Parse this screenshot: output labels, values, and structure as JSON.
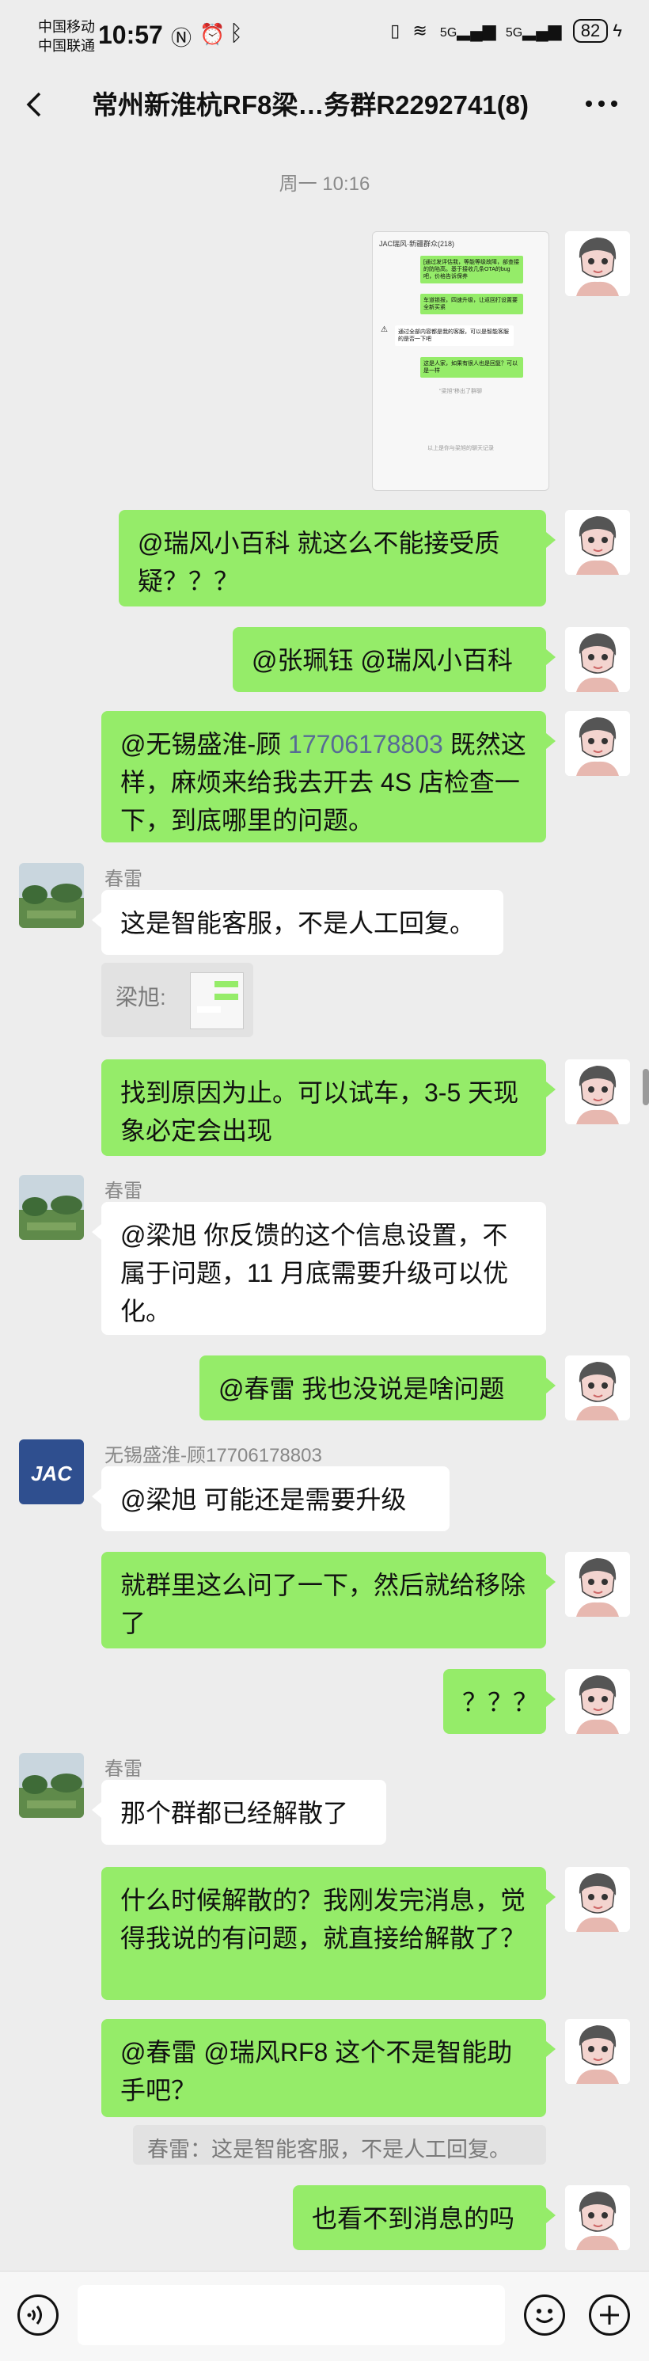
{
  "status_bar": {
    "carrier_1": "中国移动",
    "carrier_2": "中国联通",
    "time": "10:57",
    "battery": "82",
    "net_1": "5G",
    "net_2": "5G"
  },
  "header": {
    "title": "常州新淮杭RF8梁…务群R2292741(8)"
  },
  "timestamp": "周一 10:16",
  "screenshot_card": {
    "title": "JAC瑞风·新疆群众(218)",
    "reply_1": "[通过发评估我，等能等级故障，部查接的防陷高。基于接收几条OTA的bug吧，价格告诉保养",
    "reply_2": "车道锁报，四速升级，让返回打设置要全新买紧",
    "notice": "通过全部内容都是我的客服，可以是智能客服的是否一下吧",
    "reply_3": "这是人家，如果有很人也是回复？可以是一样",
    "footer_1": "\"梁旭\"移出了群聊",
    "footer_2": "以上是你与梁旭的聊天记录"
  },
  "messages": [
    {
      "id": "m1",
      "text": "@瑞风小百科  就这么不能接受质疑？？？"
    },
    {
      "id": "m2",
      "text": "@张珮钰  @瑞风小百科"
    },
    {
      "id": "m3a",
      "text": "@无锡盛淮-顾"
    },
    {
      "id": "m3b",
      "text": "17706178803"
    },
    {
      "id": "m3c",
      "text": " 既然这样，麻烦来给我去开去 4S 店检查一下，到底哪里的问题。"
    },
    {
      "id": "m4_sender",
      "text": "春雷"
    },
    {
      "id": "m4",
      "text": "这是智能客服，不是人工回复。"
    },
    {
      "id": "m4_quote",
      "text": "梁旭:"
    },
    {
      "id": "m5",
      "text": "找到原因为止。可以试车，3-5 天现象必定会出现"
    },
    {
      "id": "m6_sender",
      "text": "春雷"
    },
    {
      "id": "m6",
      "text": "@梁旭  你反馈的这个信息设置，不属于问题，11 月底需要升级可以优化。"
    },
    {
      "id": "m7",
      "text": "@春雷  我也没说是啥问题"
    },
    {
      "id": "m8_sender",
      "text": "无锡盛淮-顾17706178803"
    },
    {
      "id": "m8",
      "text": "@梁旭  可能还是需要升级"
    },
    {
      "id": "m9",
      "text": "就群里这么问了一下，然后就给移除了"
    },
    {
      "id": "m10",
      "text": "？？？"
    },
    {
      "id": "m11_sender",
      "text": "春雷"
    },
    {
      "id": "m11",
      "text": "那个群都已经解散了"
    },
    {
      "id": "m12",
      "text": "什么时候解散的？我刚发完消息，觉得我说的有问题，就直接给解散了？"
    },
    {
      "id": "m13",
      "text": "@春雷 @瑞风RF8 这个不是智能助手吧？"
    },
    {
      "id": "m13_quote",
      "text": "春雷：这是智能客服，不是人工回复。"
    },
    {
      "id": "m14",
      "text": "也看不到消息的吗"
    }
  ],
  "input_bar": {
    "voice_icon": "voice-icon",
    "emoji_icon": "emoji-icon",
    "plus_icon": "plus-icon"
  }
}
